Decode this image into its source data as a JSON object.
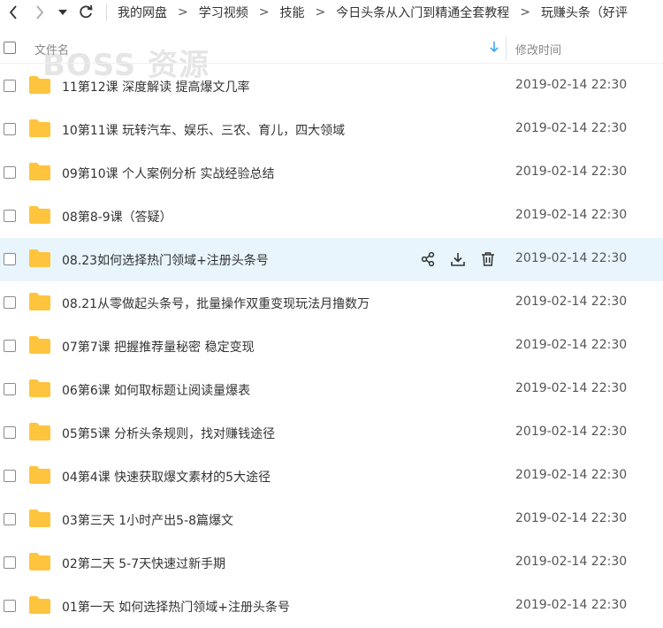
{
  "nav": {
    "breadcrumbs": [
      "我的网盘",
      "学习视频",
      "技能",
      "今日头条从入门到精通全套教程",
      "玩赚头条（好评"
    ],
    "separator": ">"
  },
  "watermark": "BOSS 资源",
  "header": {
    "name_label": "文件名",
    "time_label": "修改时间"
  },
  "colors": {
    "folder": "#ffc43d",
    "hover_row": "#e8f5fd",
    "sort_arrow": "#3da8f5"
  },
  "files": [
    {
      "name": "11第12课 深度解读 提高爆文几率",
      "time": "2019-02-14 22:30"
    },
    {
      "name": "10第11课 玩转汽车、娱乐、三农、育儿，四大领域",
      "time": "2019-02-14 22:30"
    },
    {
      "name": "09第10课 个人案例分析 实战经验总结",
      "time": "2019-02-14 22:30"
    },
    {
      "name": "08第8-9课（答疑）",
      "time": "2019-02-14 22:30"
    },
    {
      "name": "08.23如何选择热门领域+注册头条号",
      "time": "2019-02-14 22:30",
      "hovered": true
    },
    {
      "name": "08.21从零做起头条号，批量操作双重变现玩法月撸数万",
      "time": "2019-02-14 22:30"
    },
    {
      "name": "07第7课 把握推荐量秘密 稳定变现",
      "time": "2019-02-14 22:30"
    },
    {
      "name": "06第6课 如何取标题让阅读量爆表",
      "time": "2019-02-14 22:30"
    },
    {
      "name": "05第5课 分析头条规则，找对赚钱途径",
      "time": "2019-02-14 22:30"
    },
    {
      "name": "04第4课 快速获取爆文素材的5大途径",
      "time": "2019-02-14 22:30"
    },
    {
      "name": "03第三天 1小时产出5-8篇爆文",
      "time": "2019-02-14 22:30"
    },
    {
      "name": "02第二天 5-7天快速过新手期",
      "time": "2019-02-14 22:30"
    },
    {
      "name": "01第一天 如何选择热门领域+注册头条号",
      "time": "2019-02-14 22:30"
    }
  ]
}
